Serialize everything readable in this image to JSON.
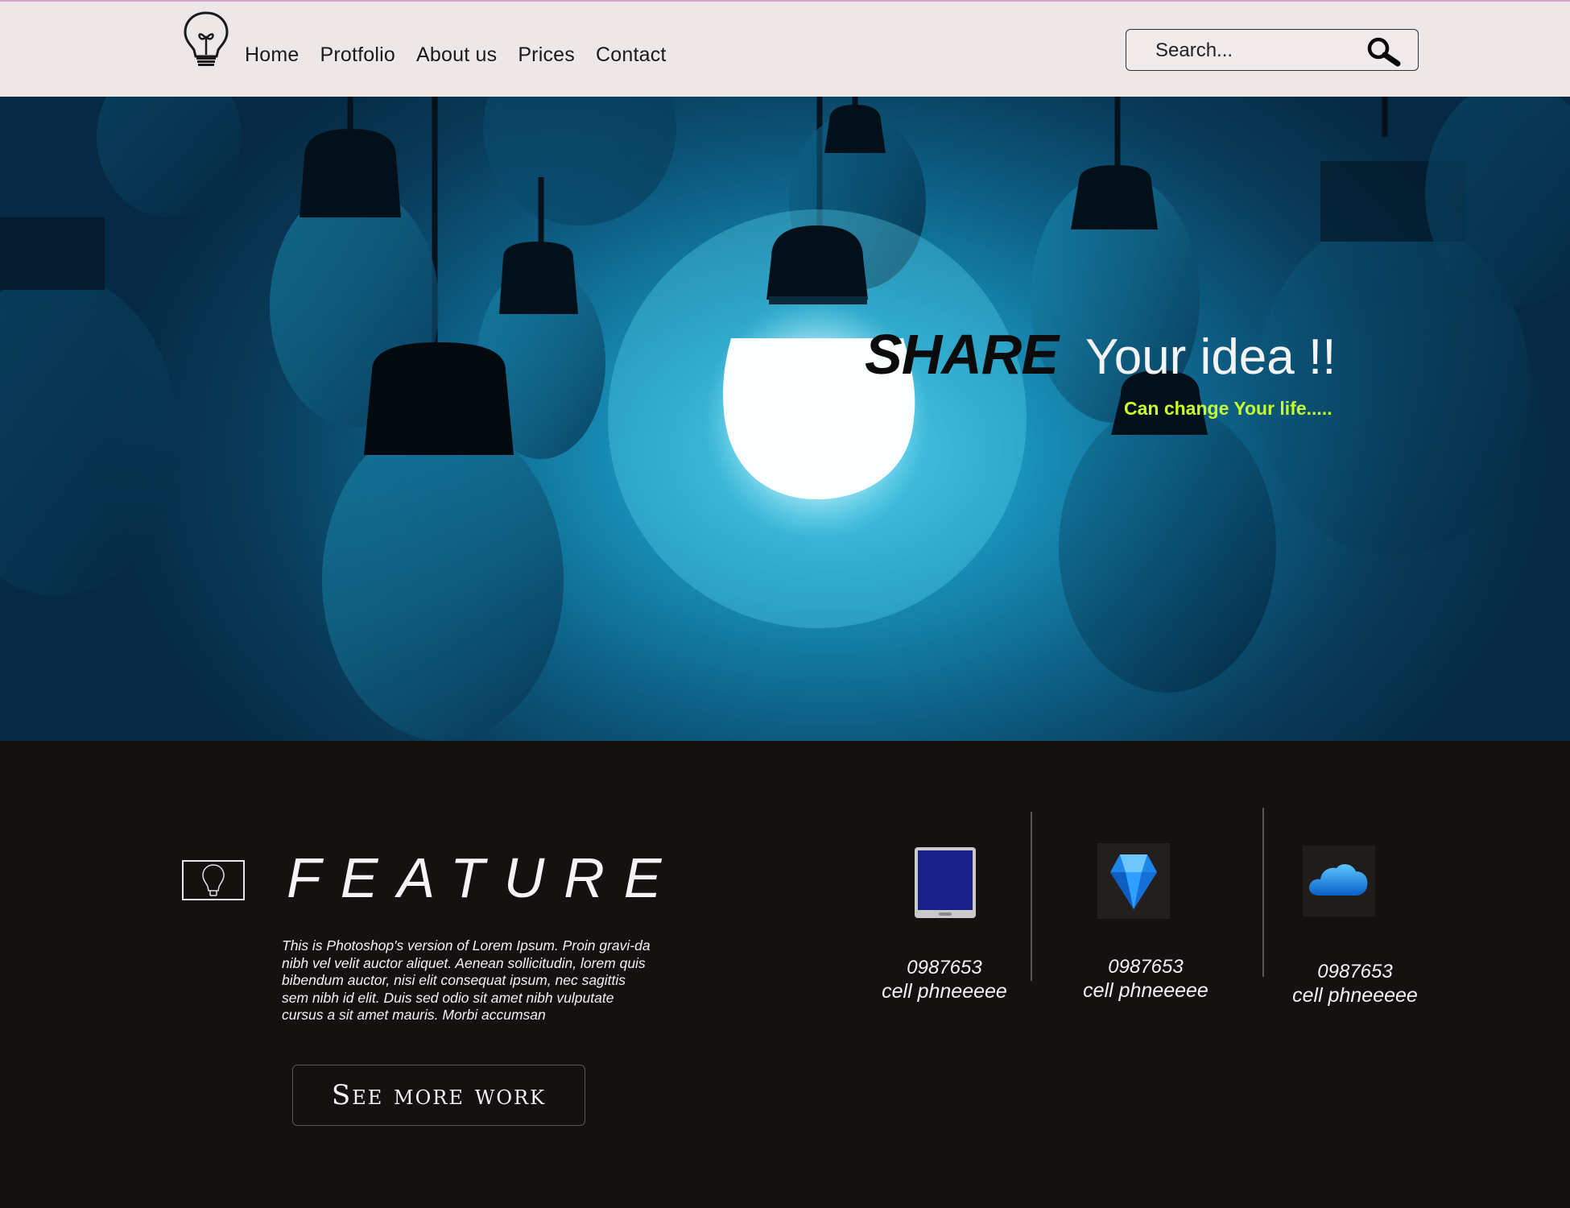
{
  "nav": {
    "items": [
      "Home",
      "Protfolio",
      "About us",
      "Prices",
      "Contact"
    ]
  },
  "search": {
    "placeholder": "Search..."
  },
  "hero": {
    "share": "SHARE",
    "rest": "Your idea !!",
    "subtitle": "Can change Your life....."
  },
  "feature": {
    "title": "FEATURE",
    "text": "This is Photoshop's version  of Lorem Ipsum. Proin gravi-da nibh vel velit auctor aliquet. Aenean sollicitudin, lorem quis bibendum auctor, nisi elit consequat ipsum, nec sagittis sem nibh id elit. Duis sed odio sit amet nibh vulputate cursus a sit amet mauris. Morbi accumsan",
    "button": "See more work"
  },
  "contacts": [
    {
      "number": "0987653",
      "label": "cell phneeeee",
      "icon": "tablet-icon"
    },
    {
      "number": "0987653",
      "label": "cell phneeeee",
      "icon": "diamond-icon"
    },
    {
      "number": "0987653",
      "label": "cell phneeeee",
      "icon": "cloud-icon"
    }
  ],
  "colors": {
    "header_bg": "#ede7e8",
    "dark_bg": "#151111",
    "accent_subtitle": "#c6ff2a",
    "hero_blue": "#1890b8"
  }
}
